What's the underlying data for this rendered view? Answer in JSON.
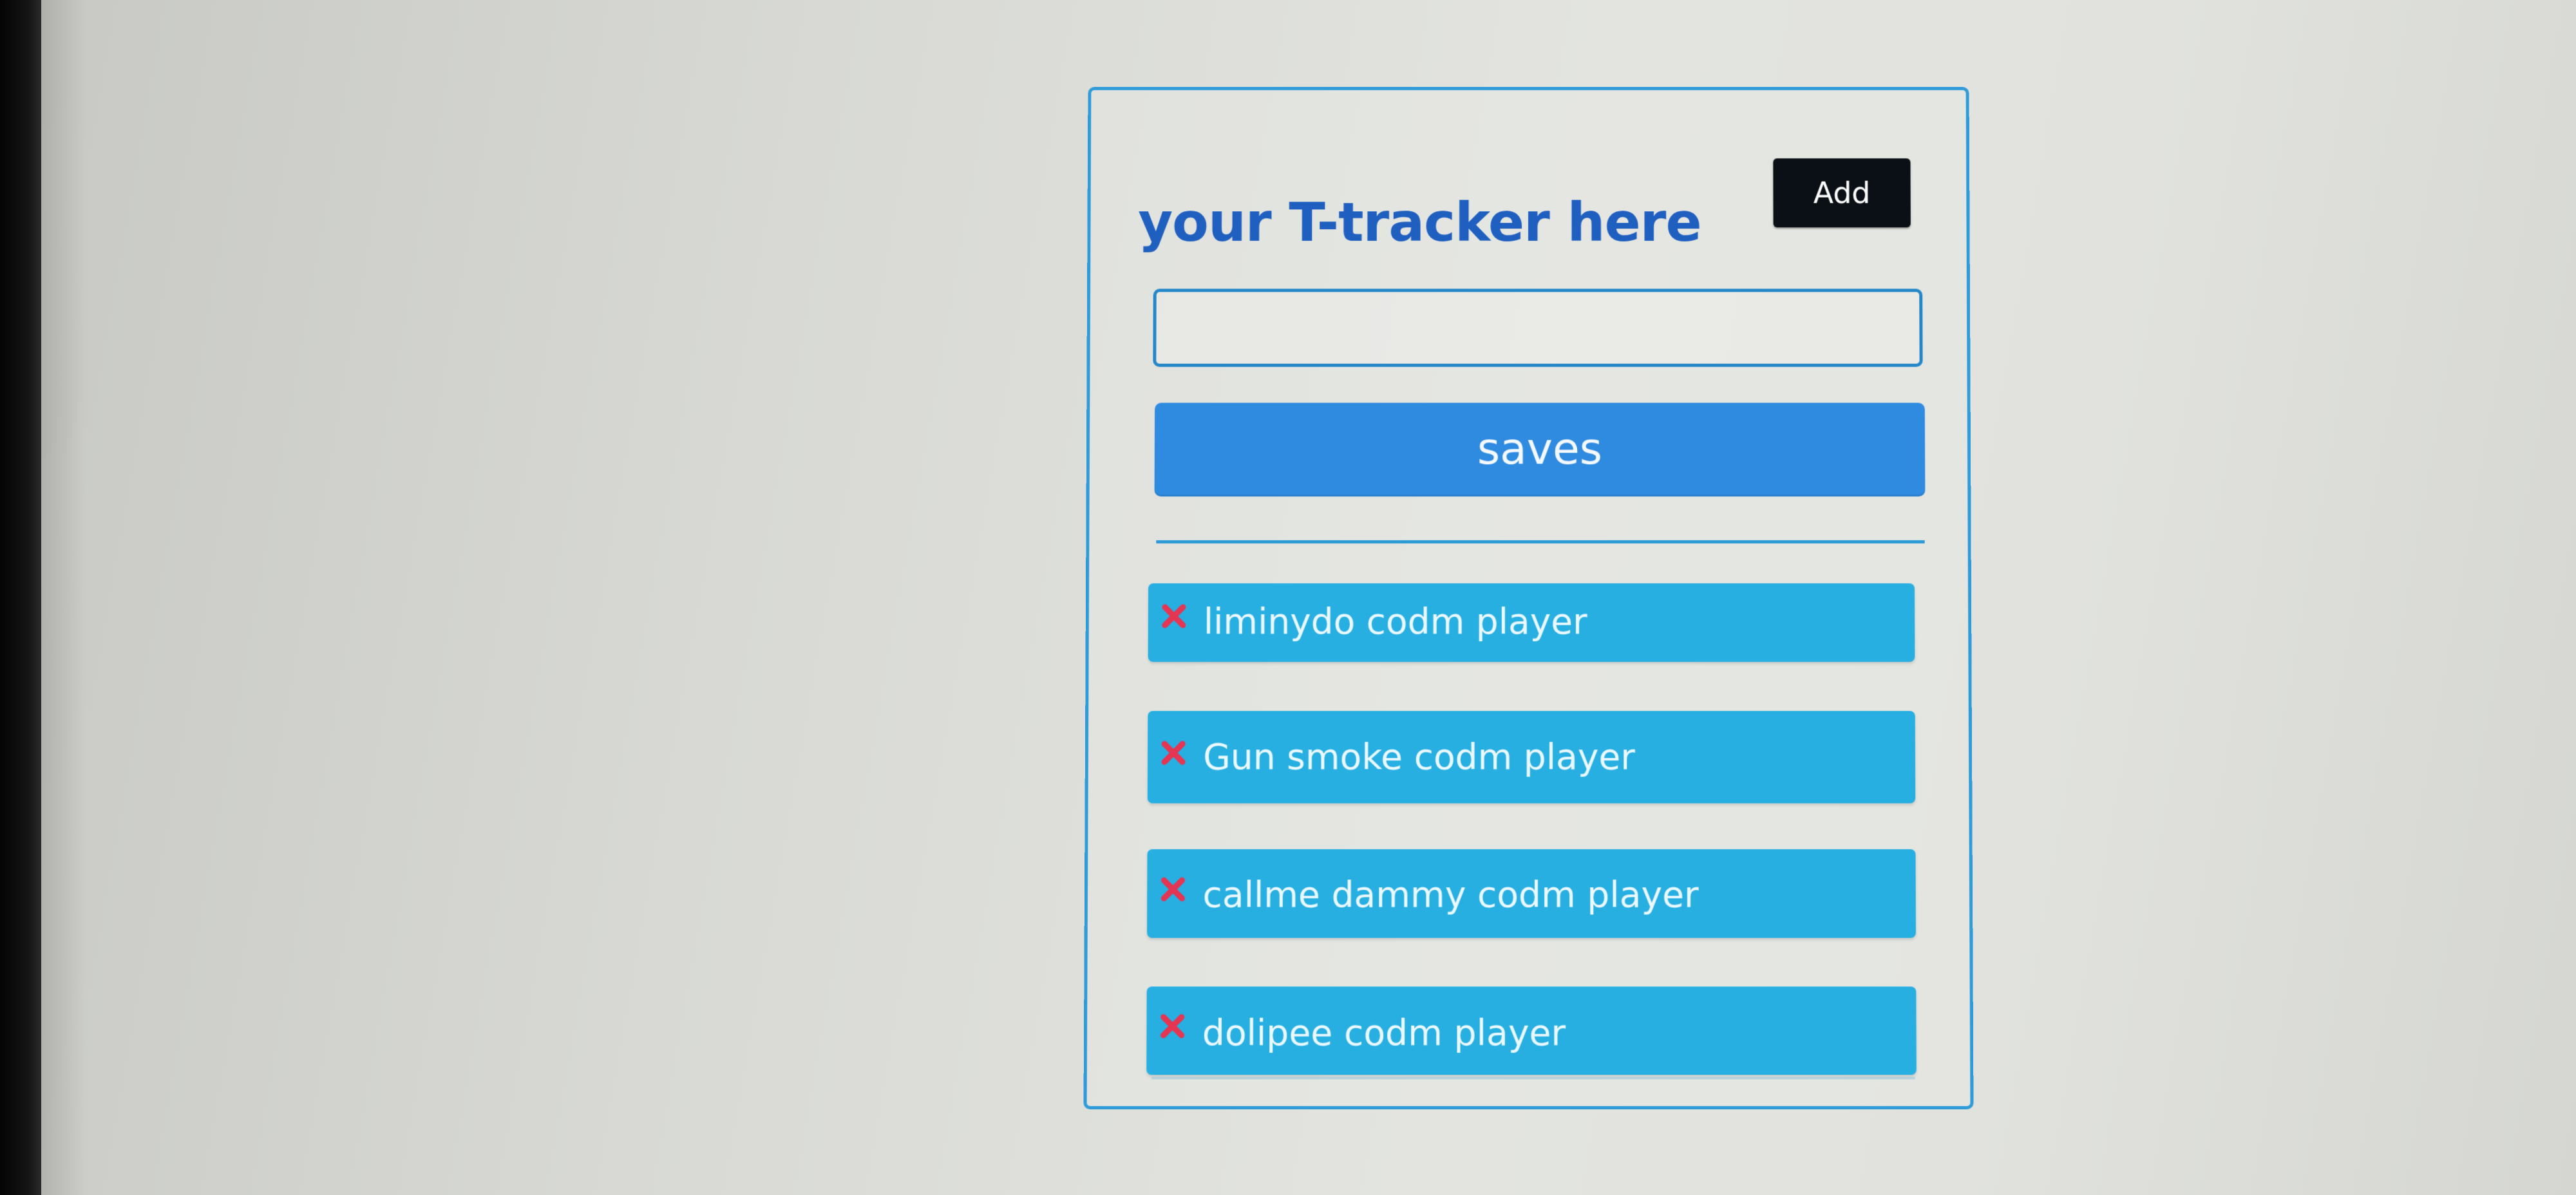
{
  "tracker": {
    "title": "your T-tracker here",
    "add_label": "Add",
    "input_value": "",
    "input_placeholder": "",
    "save_label": "saves",
    "items": [
      {
        "label": "liminydo codm player",
        "icon": "close-icon"
      },
      {
        "label": "Gun smoke codm player",
        "icon": "close-icon"
      },
      {
        "label": "callme dammy codm player",
        "icon": "close-icon"
      },
      {
        "label": "dolipee codm player",
        "icon": "close-icon"
      }
    ]
  },
  "colors": {
    "accent": "#2f9bd8",
    "title": "#1f5fbf",
    "add_button": "#0b1016",
    "save_button": "#2f8be0",
    "list_item": "#27afe2",
    "delete_icon": "#e43552"
  }
}
